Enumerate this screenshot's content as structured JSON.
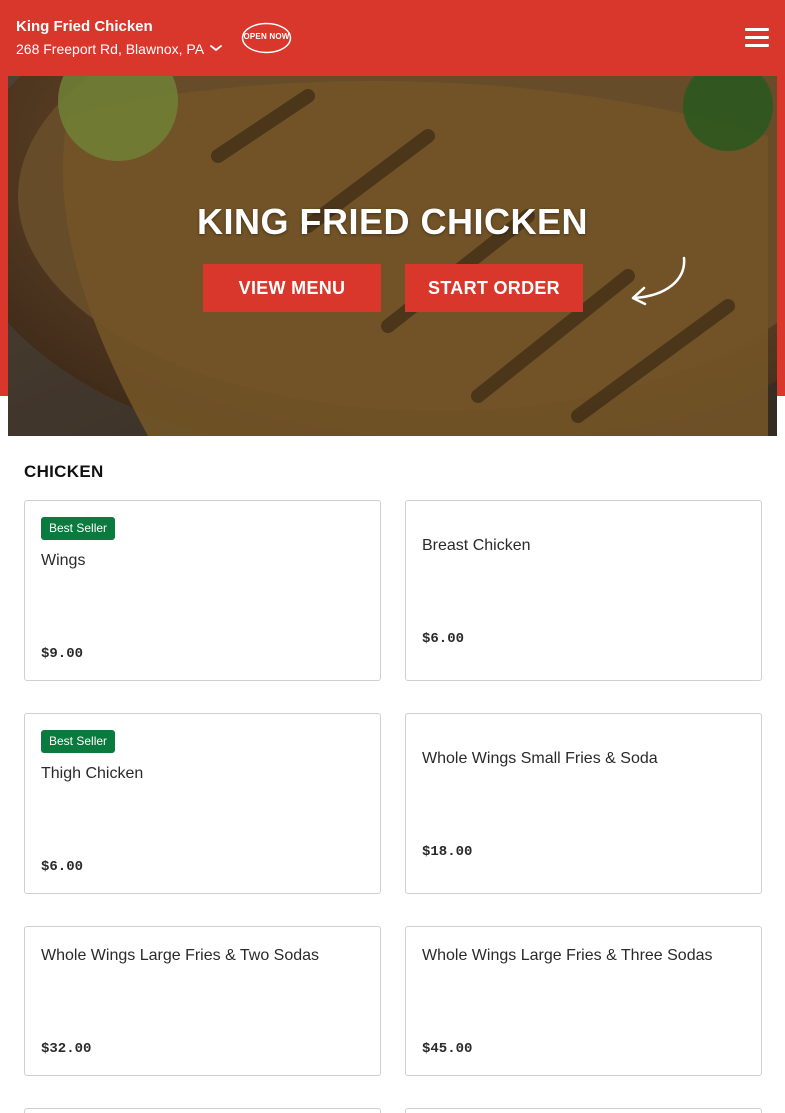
{
  "header": {
    "business_name": "King Fried Chicken",
    "address": "268 Freeport Rd, Blawnox, PA",
    "open_badge": "OPEN NOW"
  },
  "hero": {
    "title": "KING FRIED CHICKEN",
    "view_menu_label": "VIEW MENU",
    "start_order_label": "START ORDER"
  },
  "menu": {
    "section_title": "CHICKEN",
    "items": [
      {
        "name": "Wings",
        "price": "$9.00",
        "badge": "Best Seller"
      },
      {
        "name": "Breast Chicken",
        "price": "$6.00",
        "badge": ""
      },
      {
        "name": "Thigh Chicken",
        "price": "$6.00",
        "badge": "Best Seller"
      },
      {
        "name": "Whole Wings Small Fries & Soda",
        "price": "$18.00",
        "badge": ""
      },
      {
        "name": "Whole Wings Large Fries & Two Sodas",
        "price": "$32.00",
        "badge": ""
      },
      {
        "name": "Whole Wings Large Fries & Three Sodas",
        "price": "$45.00",
        "badge": ""
      }
    ]
  },
  "colors": {
    "brand_red": "#d9372b",
    "badge_green": "#0a7a3e"
  },
  "icons": {
    "menu": "hamburger-icon",
    "address_dropdown": "chevron-down-icon",
    "hero_decoration": "curved-arrow-icon"
  }
}
